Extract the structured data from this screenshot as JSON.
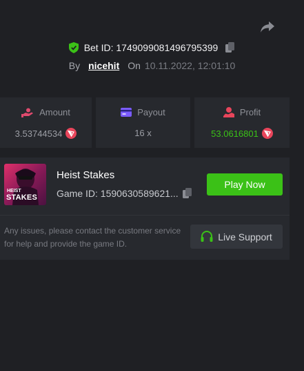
{
  "header": {
    "bet_id_label": "Bet ID: 1749099081496795399",
    "by_label": "By",
    "username": "nicehit",
    "on_label": "On",
    "date": "10.11.2022, 12:01:10"
  },
  "stats": {
    "amount": {
      "label": "Amount",
      "value": "3.53744534"
    },
    "payout": {
      "label": "Payout",
      "value": "16 x"
    },
    "profit": {
      "label": "Profit",
      "value": "53.0616801"
    }
  },
  "game": {
    "title": "Heist Stakes",
    "game_id": "Game ID: 1590630589621...",
    "play_label": "Play Now",
    "thumb_text_1": "HEIST",
    "thumb_text_2": "STAKES"
  },
  "support": {
    "notice": "Any issues, please contact the customer service for help and provide the game ID.",
    "button_label": "Live Support"
  },
  "colors": {
    "accent_green": "#3bc117",
    "profit_green": "#3bc117",
    "shield_green": "#3bc117",
    "coin_red": "#e8455b",
    "payout_purple": "#7b5cff",
    "amount_pink": "#e04a6e",
    "background": "#1f2024",
    "panel": "#27292e"
  },
  "icons": [
    "share-icon",
    "shield-check-icon",
    "copy-icon",
    "amount-icon",
    "payout-icon",
    "profit-icon",
    "trx-coin-icon",
    "headset-icon"
  ]
}
